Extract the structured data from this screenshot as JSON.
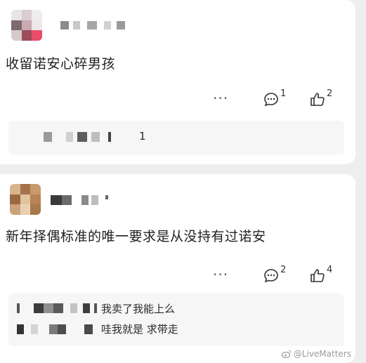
{
  "posts": [
    {
      "text": "收留诺安心碎男孩",
      "comment_count": "1",
      "like_count": "2",
      "reply_stub_count": "1"
    },
    {
      "text": "新年择偶标准的唯一要求是从没持有过诺安",
      "comment_count": "2",
      "like_count": "4",
      "replies": [
        {
          "text": "我卖了我能上么"
        },
        {
          "text": "哇我就是 求带走"
        }
      ]
    }
  ],
  "icons": {
    "more": "more-dots-icon",
    "comment": "comment-bubble-icon",
    "like": "thumbs-up-icon"
  },
  "watermark": "@LiveMatters",
  "colors": {
    "background": "#eeeeee",
    "card": "#ffffff",
    "reply_box": "#f6f6f6"
  }
}
